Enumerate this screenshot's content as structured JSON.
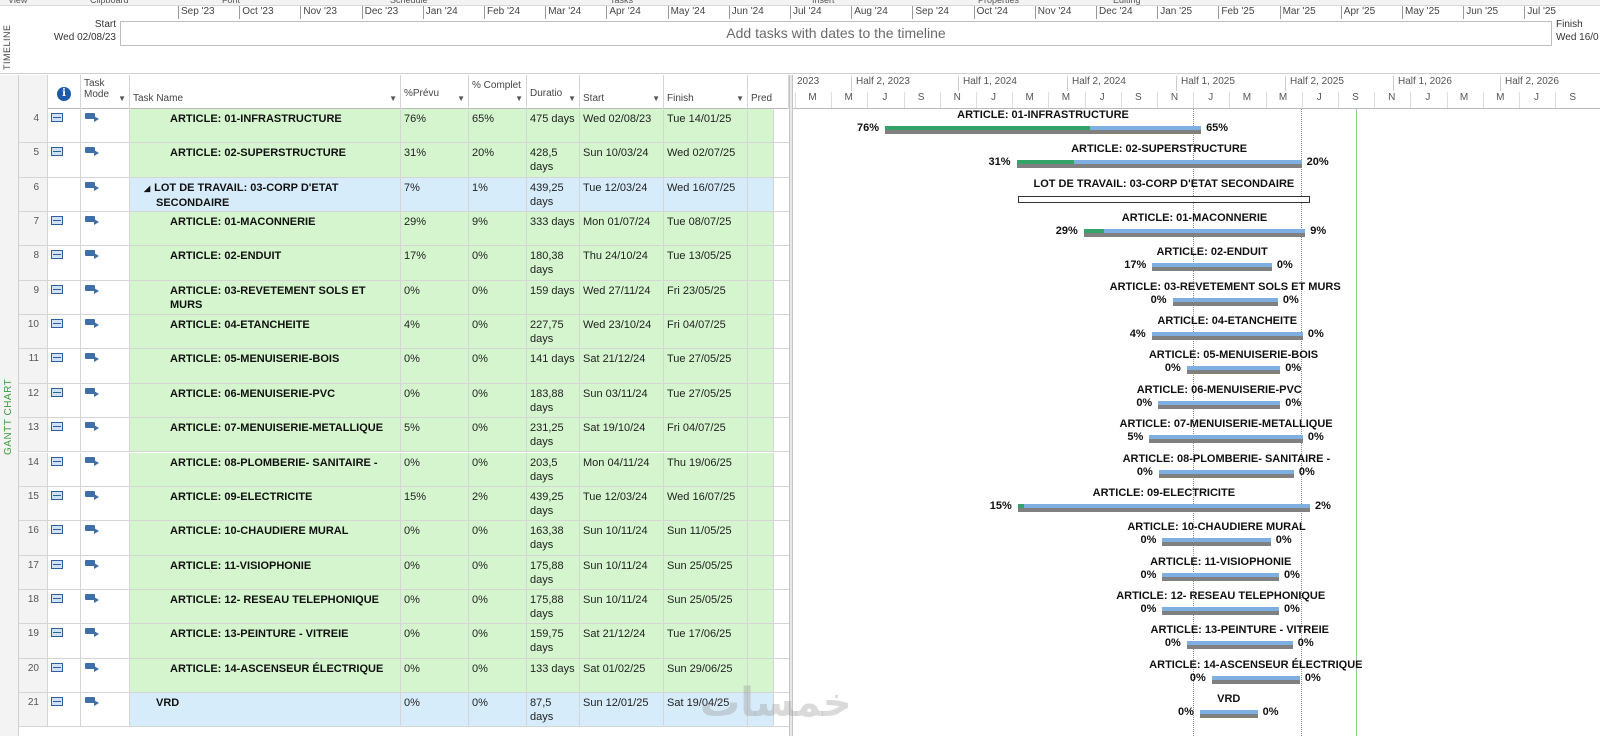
{
  "ribbon": {
    "groups": [
      "View",
      "Clipboard",
      "Font",
      "Schedule",
      "Tasks",
      "Insert",
      "Properties",
      "Editing"
    ]
  },
  "timeline": {
    "side_label": "TIMELINE",
    "start_label": "Start",
    "start_date": "Wed 02/08/23",
    "finish_label": "Finish",
    "finish_date": "Wed 16/0",
    "placeholder": "Add tasks with dates to the timeline",
    "months": [
      "Sep '23",
      "Oct '23",
      "Nov '23",
      "Dec '23",
      "Jan '24",
      "Feb '24",
      "Mar '24",
      "Apr '24",
      "May '24",
      "Jun '24",
      "Jul '24",
      "Aug '24",
      "Sep '24",
      "Oct '24",
      "Nov '24",
      "Dec '24",
      "Jan '25",
      "Feb '25",
      "Mar '25",
      "Apr '25",
      "May '25",
      "Jun '25",
      "Jul '25"
    ]
  },
  "view": {
    "side_label": "GANTT CHART"
  },
  "columns": {
    "info_icon": "info-icon",
    "task_mode": "Task Mode",
    "task_name": "Task Name",
    "prevu": "%Prévu",
    "complete": "% Complet",
    "duration": "Duratio",
    "start": "Start",
    "finish": "Finish",
    "pred": "Pred"
  },
  "tasks": [
    {
      "id": "4",
      "name": "ARTICLE: 01-INFRASTRUCTURE",
      "prevu": "76%",
      "complete": "65%",
      "duration": "475 days",
      "start": "Wed 02/08/23",
      "finish": "Tue 14/01/25",
      "kind": "task",
      "plan_pct": 76,
      "done_pct": 65
    },
    {
      "id": "5",
      "name": "ARTICLE: 02-SUPERSTRUCTURE",
      "prevu": "31%",
      "complete": "20%",
      "duration": "428,5 days",
      "start": "Sun 10/03/24",
      "finish": "Wed 02/07/25",
      "kind": "task",
      "plan_pct": 31,
      "done_pct": 20
    },
    {
      "id": "6",
      "name": "LOT DE TRAVAIL: 03-CORP D'ETAT SECONDAIRE",
      "prevu": "7%",
      "complete": "1%",
      "duration": "439,25 days",
      "start": "Tue 12/03/24",
      "finish": "Wed 16/07/25",
      "kind": "summary",
      "plan_pct": 7,
      "done_pct": 1
    },
    {
      "id": "7",
      "name": "ARTICLE: 01-MACONNERIE",
      "prevu": "29%",
      "complete": "9%",
      "duration": "333 days",
      "start": "Mon 01/07/24",
      "finish": "Tue 08/07/25",
      "kind": "task",
      "plan_pct": 29,
      "done_pct": 9
    },
    {
      "id": "8",
      "name": "ARTICLE: 02-ENDUIT",
      "prevu": "17%",
      "complete": "0%",
      "duration": "180,38 days",
      "start": "Thu 24/10/24",
      "finish": "Tue 13/05/25",
      "kind": "task",
      "plan_pct": 17,
      "done_pct": 0
    },
    {
      "id": "9",
      "name": "ARTICLE: 03-REVETEMENT SOLS ET MURS",
      "prevu": "0%",
      "complete": "0%",
      "duration": "159 days",
      "start": "Wed 27/11/24",
      "finish": "Fri 23/05/25",
      "kind": "task",
      "plan_pct": 0,
      "done_pct": 0
    },
    {
      "id": "10",
      "name": "ARTICLE: 04-ETANCHEITE",
      "prevu": "4%",
      "complete": "0%",
      "duration": "227,75 days",
      "start": "Wed 23/10/24",
      "finish": "Fri 04/07/25",
      "kind": "task",
      "plan_pct": 4,
      "done_pct": 0
    },
    {
      "id": "11",
      "name": "ARTICLE: 05-MENUISERIE-BOIS",
      "prevu": "0%",
      "complete": "0%",
      "duration": "141 days",
      "start": "Sat 21/12/24",
      "finish": "Tue 27/05/25",
      "kind": "task",
      "plan_pct": 0,
      "done_pct": 0
    },
    {
      "id": "12",
      "name": "ARTICLE: 06-MENUISERIE-PVC",
      "prevu": "0%",
      "complete": "0%",
      "duration": "183,88 days",
      "start": "Sun 03/11/24",
      "finish": "Tue 27/05/25",
      "kind": "task",
      "plan_pct": 0,
      "done_pct": 0
    },
    {
      "id": "13",
      "name": "ARTICLE: 07-MENUISERIE-METALLIQUE",
      "prevu": "5%",
      "complete": "0%",
      "duration": "231,25 days",
      "start": "Sat 19/10/24",
      "finish": "Fri 04/07/25",
      "kind": "task",
      "plan_pct": 5,
      "done_pct": 0
    },
    {
      "id": "14",
      "name": "ARTICLE: 08-PLOMBERIE- SANITAIRE -",
      "prevu": "0%",
      "complete": "0%",
      "duration": "203,5 days",
      "start": "Mon 04/11/24",
      "finish": "Thu 19/06/25",
      "kind": "task",
      "plan_pct": 0,
      "done_pct": 0
    },
    {
      "id": "15",
      "name": "ARTICLE: 09-ELECTRICITE",
      "prevu": "15%",
      "complete": "2%",
      "duration": "439,25 days",
      "start": "Tue 12/03/24",
      "finish": "Wed 16/07/25",
      "kind": "task",
      "plan_pct": 15,
      "done_pct": 2
    },
    {
      "id": "16",
      "name": "ARTICLE: 10-CHAUDIERE MURAL",
      "prevu": "0%",
      "complete": "0%",
      "duration": "163,38 days",
      "start": "Sun 10/11/24",
      "finish": "Sun 11/05/25",
      "kind": "task",
      "plan_pct": 0,
      "done_pct": 0
    },
    {
      "id": "17",
      "name": "ARTICLE: 11-VISIOPHONIE",
      "prevu": "0%",
      "complete": "0%",
      "duration": "175,88 days",
      "start": "Sun 10/11/24",
      "finish": "Sun 25/05/25",
      "kind": "task",
      "plan_pct": 0,
      "done_pct": 0
    },
    {
      "id": "18",
      "name": "ARTICLE: 12- RESEAU TELEPHONIQUE",
      "prevu": "0%",
      "complete": "0%",
      "duration": "175,88 days",
      "start": "Sun 10/11/24",
      "finish": "Sun 25/05/25",
      "kind": "task",
      "plan_pct": 0,
      "done_pct": 0
    },
    {
      "id": "19",
      "name": "ARTICLE: 13-PEINTURE - VITREIE",
      "prevu": "0%",
      "complete": "0%",
      "duration": "159,75 days",
      "start": "Sat 21/12/24",
      "finish": "Tue 17/06/25",
      "kind": "task",
      "plan_pct": 0,
      "done_pct": 0
    },
    {
      "id": "20",
      "name": "ARTICLE: 14-ASCENSEUR ÉLECTRIQUE",
      "prevu": "0%",
      "complete": "0%",
      "duration": "133 days",
      "start": "Sat 01/02/25",
      "finish": "Sun 29/06/25",
      "kind": "task",
      "plan_pct": 0,
      "done_pct": 0
    },
    {
      "id": "21",
      "name": "VRD",
      "prevu": "0%",
      "complete": "0%",
      "duration": "87,5 days",
      "start": "Sun 12/01/25",
      "finish": "Sat 19/04/25",
      "kind": "vrd",
      "plan_pct": 0,
      "done_pct": 0
    }
  ],
  "gantt": {
    "halves": [
      "2023",
      "Half 2, 2023",
      "Half 1, 2024",
      "Half 2, 2024",
      "Half 1, 2025",
      "Half 2, 2025",
      "Half 1, 2026",
      "Half 2, 2026"
    ],
    "months": [
      "M",
      "M",
      "J",
      "S",
      "N",
      "J",
      "M",
      "M",
      "J",
      "S",
      "N",
      "J",
      "M",
      "M",
      "J",
      "S",
      "N",
      "J",
      "M",
      "M",
      "J",
      "S"
    ]
  },
  "colors": {
    "task_row": "#d4f5cd",
    "summary_row": "#d7ecfa",
    "baseline_bar": "#808080",
    "plan_bar": "#7faee0",
    "progress_bar": "#34a36a",
    "view_label": "#3d9b3d"
  }
}
